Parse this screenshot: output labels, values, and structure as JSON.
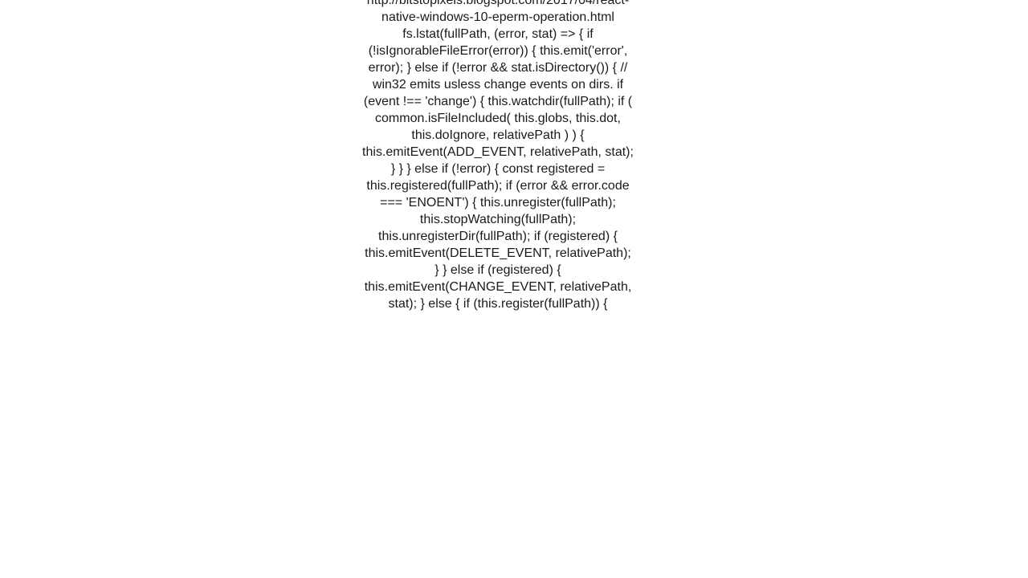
{
  "code_text": "= path.join(path.relative(this.root, dir), file); // Use isIgnorableFileError to ignore EPERM errors on Windows machines // when watching the file system. E.g. http://bitstopixels.blogspot.com/2017/04/react-native-windows-10-eperm-operation.html   fs.lstat(fullPath, (error, stat) => {    if (!isIgnorableFileError(error)) {     this.emit('error', error);    } else if (!error && stat.isDirectory()) {     // win32 emits usless change events on dirs.     if (event !== 'change') {      this.watchdir(fullPath);       if (       common.isFileIncluded(        this.globs,             this.dot,        this.doIgnore,             relativePath       )      ) {       this.emitEvent(ADD_EVENT, relativePath, stat);      }     }    } else if (!error) {     const registered = this.registered(fullPath);      if (error && error.code === 'ENOENT') {      this.unregister(fullPath);      this.stopWatching(fullPath);      this.unregisterDir(fullPath);       if (registered) {       this.emitEvent(DELETE_EVENT, relativePath);      }     } else if (registered) {      this.emitEvent(CHANGE_EVENT, relativePath, stat);     } else {      if (this.register(fullPath)) {"
}
